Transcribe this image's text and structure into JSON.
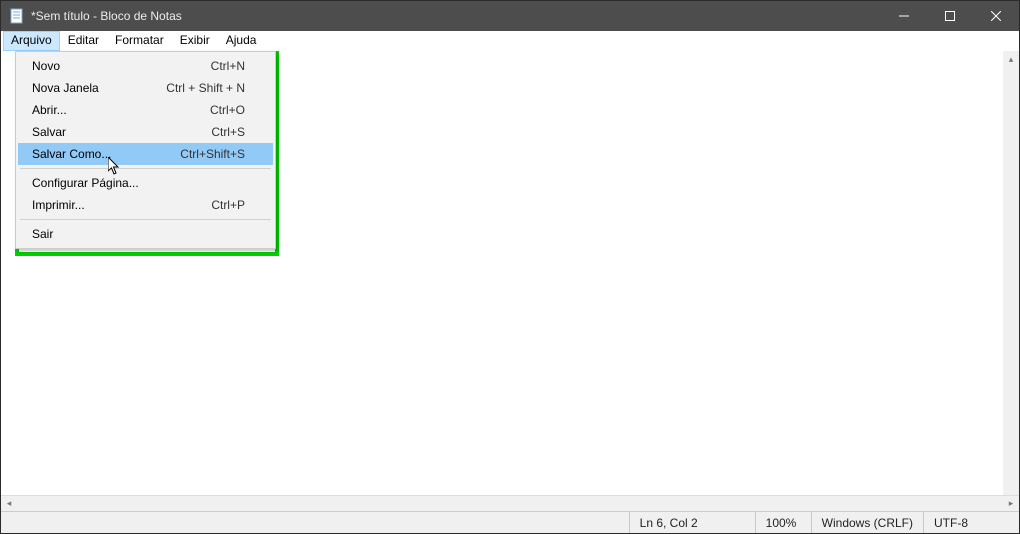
{
  "title": "*Sem título - Bloco de Notas",
  "menu": {
    "arquivo": "Arquivo",
    "editar": "Editar",
    "formatar": "Formatar",
    "exibir": "Exibir",
    "ajuda": "Ajuda"
  },
  "dropdown": {
    "novo": {
      "label": "Novo",
      "shortcut": "Ctrl+N"
    },
    "novajanela": {
      "label": "Nova Janela",
      "shortcut": "Ctrl + Shift + N"
    },
    "abrir": {
      "label": "Abrir...",
      "shortcut": "Ctrl+O"
    },
    "salvar": {
      "label": "Salvar",
      "shortcut": "Ctrl+S"
    },
    "salvarcomo": {
      "label": "Salvar Como...",
      "shortcut": "Ctrl+Shift+S"
    },
    "configpagina": {
      "label": "Configurar Página...",
      "shortcut": ""
    },
    "imprimir": {
      "label": "Imprimir...",
      "shortcut": "Ctrl+P"
    },
    "sair": {
      "label": "Sair",
      "shortcut": ""
    }
  },
  "status": {
    "position": "Ln 6, Col 2",
    "zoom": "100%",
    "line_ending": "Windows (CRLF)",
    "encoding": "UTF-8"
  }
}
